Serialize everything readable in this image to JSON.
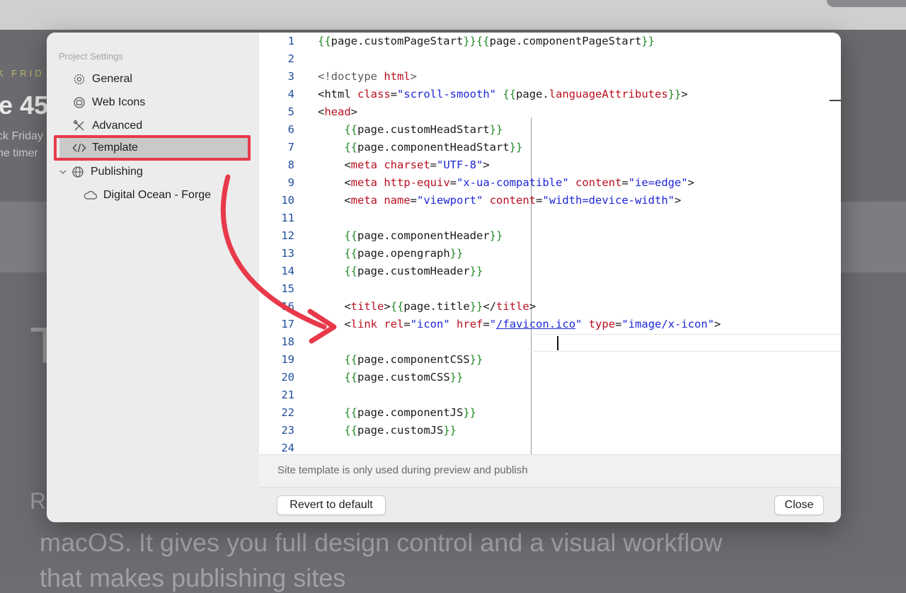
{
  "background": {
    "eyebrow": "K FRID",
    "headline": "e 45",
    "subtitle_line1": "ck Friday",
    "subtitle_line2": "he timer",
    "big_letter": "T",
    "para_lead": "R",
    "para_line1": "macOS. It gives you full design control and a visual workflow",
    "para_line2": "that makes publishing sites"
  },
  "sidebar": {
    "title": "Project Settings",
    "items": [
      {
        "label": "General",
        "icon": "gear-icon"
      },
      {
        "label": "Web Icons",
        "icon": "web-icons-icon"
      },
      {
        "label": "Advanced",
        "icon": "tools-icon"
      },
      {
        "label": "Template",
        "icon": "code-icon",
        "selected": true
      },
      {
        "label": "Publishing",
        "icon": "globe-icon",
        "expanded": true
      },
      {
        "label": "Digital Ocean - Forge",
        "icon": "cloud-icon"
      }
    ]
  },
  "editor": {
    "line_numbers": [
      "1",
      "2",
      "3",
      "4",
      "5",
      "6",
      "7",
      "8",
      "9",
      "10",
      "11",
      "12",
      "13",
      "14",
      "15",
      "16",
      "17",
      "18",
      "19",
      "20",
      "21",
      "22",
      "23",
      "24"
    ],
    "current_line": 18
  },
  "footer": {
    "note": "Site template is only used during preview and publish",
    "revert_label": "Revert to default",
    "close_label": "Close"
  },
  "colors": {
    "highlight_red": "#e8394a",
    "tag_red": "#b8101f",
    "string_blue": "#1c26d6",
    "brace_green": "#1f8a25"
  }
}
